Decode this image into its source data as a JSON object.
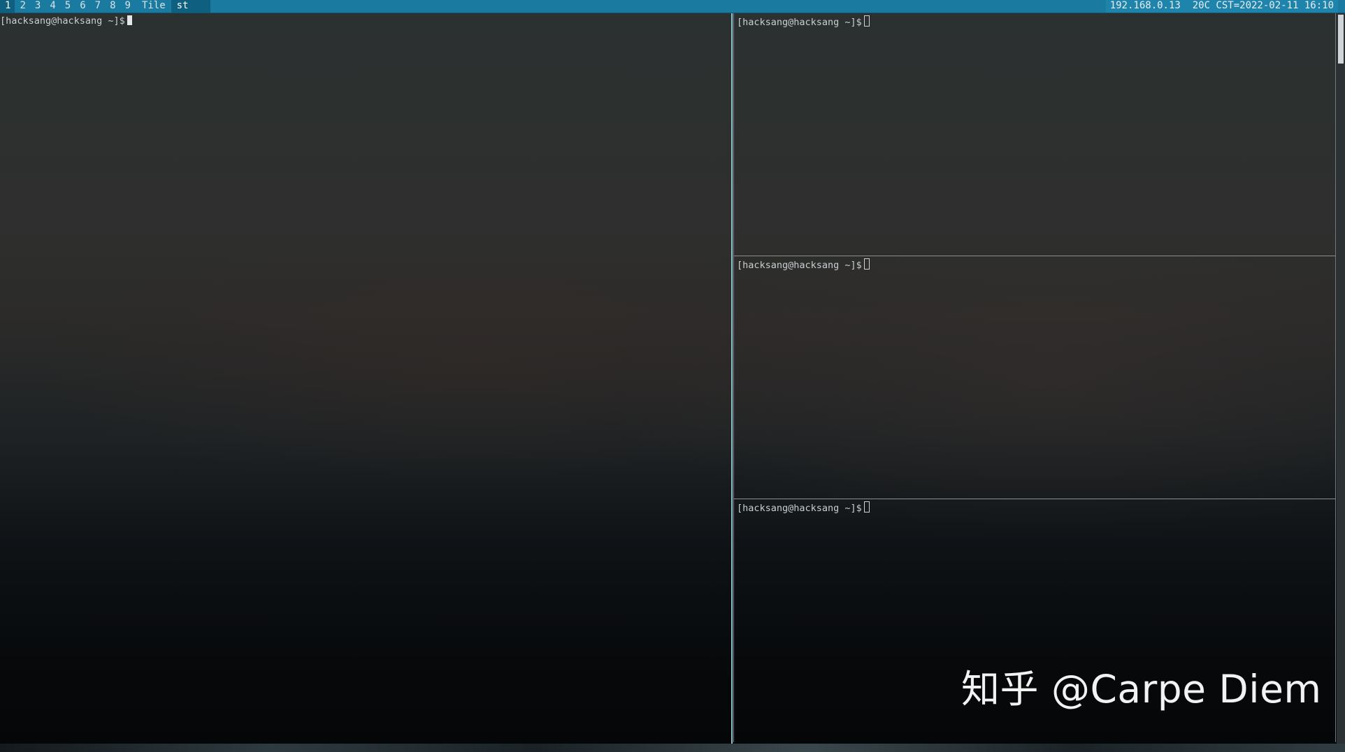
{
  "topbar": {
    "tags": [
      "1",
      "2",
      "3",
      "4",
      "5",
      "6",
      "7",
      "8",
      "9"
    ],
    "active_tag": "1",
    "layout": "Tile",
    "window_title": "st",
    "status": "192.168.0.13  20C CST=2022-02-11 16:10"
  },
  "panes": {
    "main": {
      "prompt": "[hacksang@hacksang ~]$"
    },
    "right_top": {
      "prompt": "[hacksang@hacksang ~]$"
    },
    "right_middle": {
      "prompt": "[hacksang@hacksang ~]$"
    },
    "right_bottom": {
      "prompt": "[hacksang@hacksang ~]$"
    }
  },
  "watermark": "知乎 @Carpe Diem",
  "colors": {
    "bar": "#1a7aa0",
    "bar_active": "#0f5f80",
    "focused_border": "#8fc3d0",
    "terminal_text": "#c9ced0"
  }
}
